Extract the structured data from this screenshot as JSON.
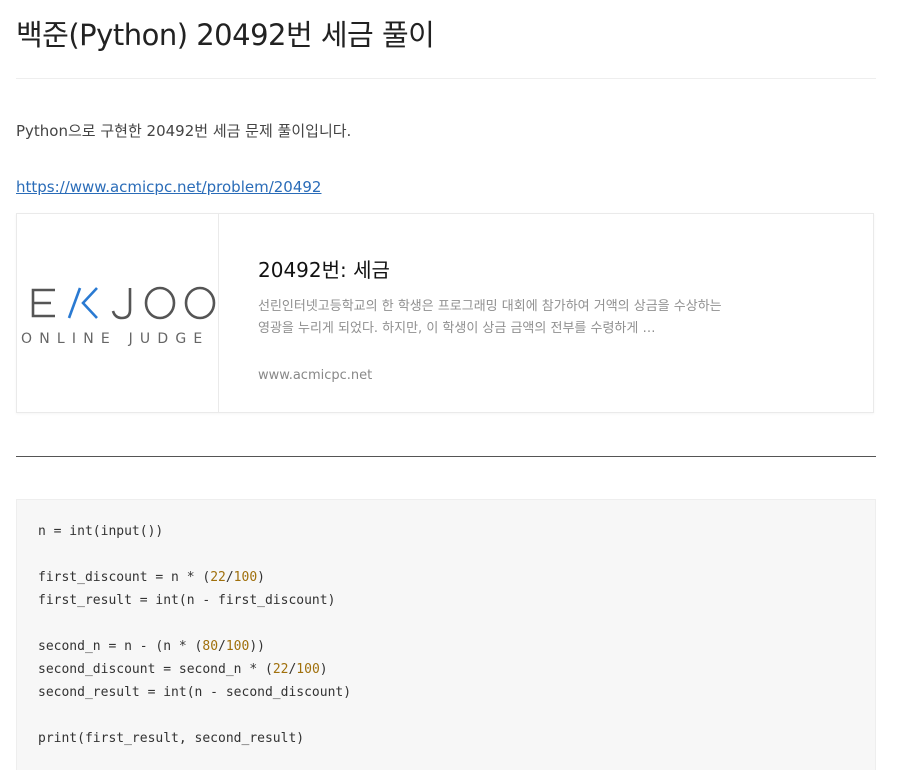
{
  "post": {
    "title": "백준(Python) 20492번 세금 풀이",
    "intro": "Python으로 구현한 20492번 세금 문제 풀이입니다.",
    "link_url": "https://www.acmicpc.net/problem/20492"
  },
  "card": {
    "logo_main": "E/KJOO",
    "logo_sub": "ONLINE JUDGE",
    "title": "20492번: 세금",
    "description": "선린인터넷고등학교의 한 학생은 프로그래밍 대회에 참가하여 거액의 상금을 수상하는 영광을 누리게 되었다. 하지만, 이 학생이 상금 금액의 전부를 수령하게 …",
    "domain": "www.acmicpc.net",
    "logo_color": "#555555",
    "logo_accent": "#2a7ad2"
  },
  "code": {
    "l1": "n = int(input())",
    "l3a": "first_discount = n * (",
    "l3n1": "22",
    "l3s": "/",
    "l3n2": "100",
    "l3b": ")",
    "l4": "first_result = int(n - first_discount)",
    "l6a": "second_n = n - (n * (",
    "l6n1": "80",
    "l6s": "/",
    "l6n2": "100",
    "l6b": "))",
    "l7a": "second_discount = second_n * (",
    "l7n1": "22",
    "l7s": "/",
    "l7n2": "100",
    "l7b": ")",
    "l8": "second_result = int(n - second_discount)",
    "l10": "print(first_result, second_result)",
    "number_color": "#a0700c"
  }
}
